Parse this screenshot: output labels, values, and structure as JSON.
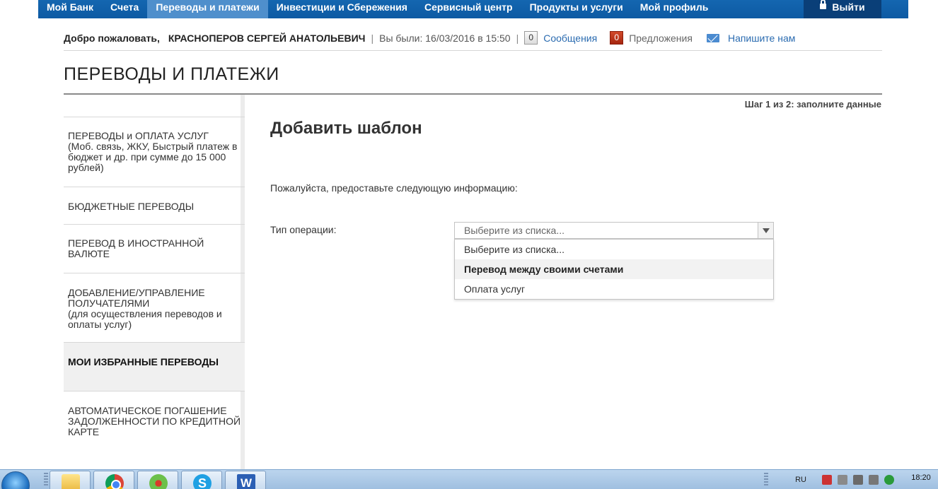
{
  "topnav": {
    "items": [
      "Мой Банк",
      "Счета",
      "Переводы и платежи",
      "Инвестиции и Сбережения",
      "Сервисный центр",
      "Продукты и услуги",
      "Мой профиль"
    ],
    "active_index": 2,
    "logout": "Выйти"
  },
  "welcome": {
    "greeting": "Добро пожаловать,",
    "user_name": "КРАСНОПЕРОВ СЕРГЕЙ АНАТОЛЬЕВИЧ",
    "last_visit": "Вы были: 16/03/2016 в 15:50",
    "messages_count": "0",
    "messages_label": "Сообщения",
    "offers_count": "0",
    "offers_label": "Предложения",
    "write_us_label": "Напишите нам"
  },
  "page": {
    "title": "ПЕРЕВОДЫ И ПЛАТЕЖИ",
    "step": "Шаг 1 из 2: заполните данные"
  },
  "sidebar": {
    "items": [
      {
        "label": "ПЕРЕВОДЫ и ОПЛАТА УСЛУГ",
        "sub": "(Моб. связь, ЖКУ, Быстрый платеж в бюджет и др. при сумме до 15 000 рублей)"
      },
      {
        "label": "БЮДЖЕТНЫЕ ПЕРЕВОДЫ",
        "sub": ""
      },
      {
        "label": "ПЕРЕВОД В ИНОСТРАННОЙ ВАЛЮТЕ",
        "sub": ""
      },
      {
        "label": "ДОБАВЛЕНИЕ/УПРАВЛЕНИЕ ПОЛУЧАТЕЛЯМИ",
        "sub": "(для осуществления переводов и оплаты услуг)"
      },
      {
        "label": "МОИ ИЗБРАННЫЕ ПЕРЕВОДЫ",
        "sub": ""
      },
      {
        "label": "АВТОМАТИЧЕСКОЕ ПОГАШЕНИЕ ЗАДОЛЖЕННОСТИ ПО КРЕДИТНОЙ КАРТЕ",
        "sub": ""
      }
    ],
    "active_index": 4
  },
  "form": {
    "title": "Добавить шаблон",
    "info": "Пожалуйста, предоставьте следующую информацию:",
    "operation_label": "Тип операции:",
    "select_value": "Выберите из списка...",
    "options": [
      "Выберите из списка...",
      "Перевод между своими счетами",
      "Оплата услуг"
    ],
    "highlighted_option_index": 1
  },
  "taskbar": {
    "lang": "RU",
    "time": "18:20",
    "apps": [
      "folder-icon",
      "chrome-icon",
      "icq-icon",
      "skype-icon",
      "word-icon"
    ],
    "skype_letter": "S",
    "word_letter": "W"
  },
  "colors": {
    "nav_blue": "#0d5aa3",
    "nav_active": "#4f8fcc",
    "link": "#2a6bb0",
    "offers_badge": "#a6260f"
  }
}
